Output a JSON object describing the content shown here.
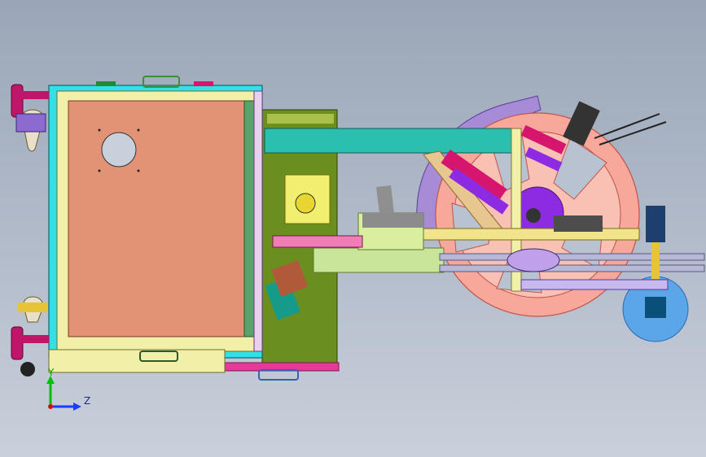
{
  "triad": {
    "axis_y_label": "Y",
    "axis_z_label": "Z",
    "colors": {
      "y": "#00c000",
      "z": "#1a3cff",
      "x": "#d01010"
    }
  },
  "palette": {
    "frame_cyan": "#33e0e8",
    "panel_salmon": "#e39375",
    "frame_yellow": "#f2f0a8",
    "base_green": "#6b8f1e",
    "beam_teal": "#2bbfb0",
    "wheel_pink": "#f7a89a",
    "arc_lavender": "#a78bd6",
    "rail_yellow": "#f1e48a",
    "magenta": "#d6166e",
    "purple": "#8d2be2",
    "blue_disc": "#5aa6e8"
  }
}
